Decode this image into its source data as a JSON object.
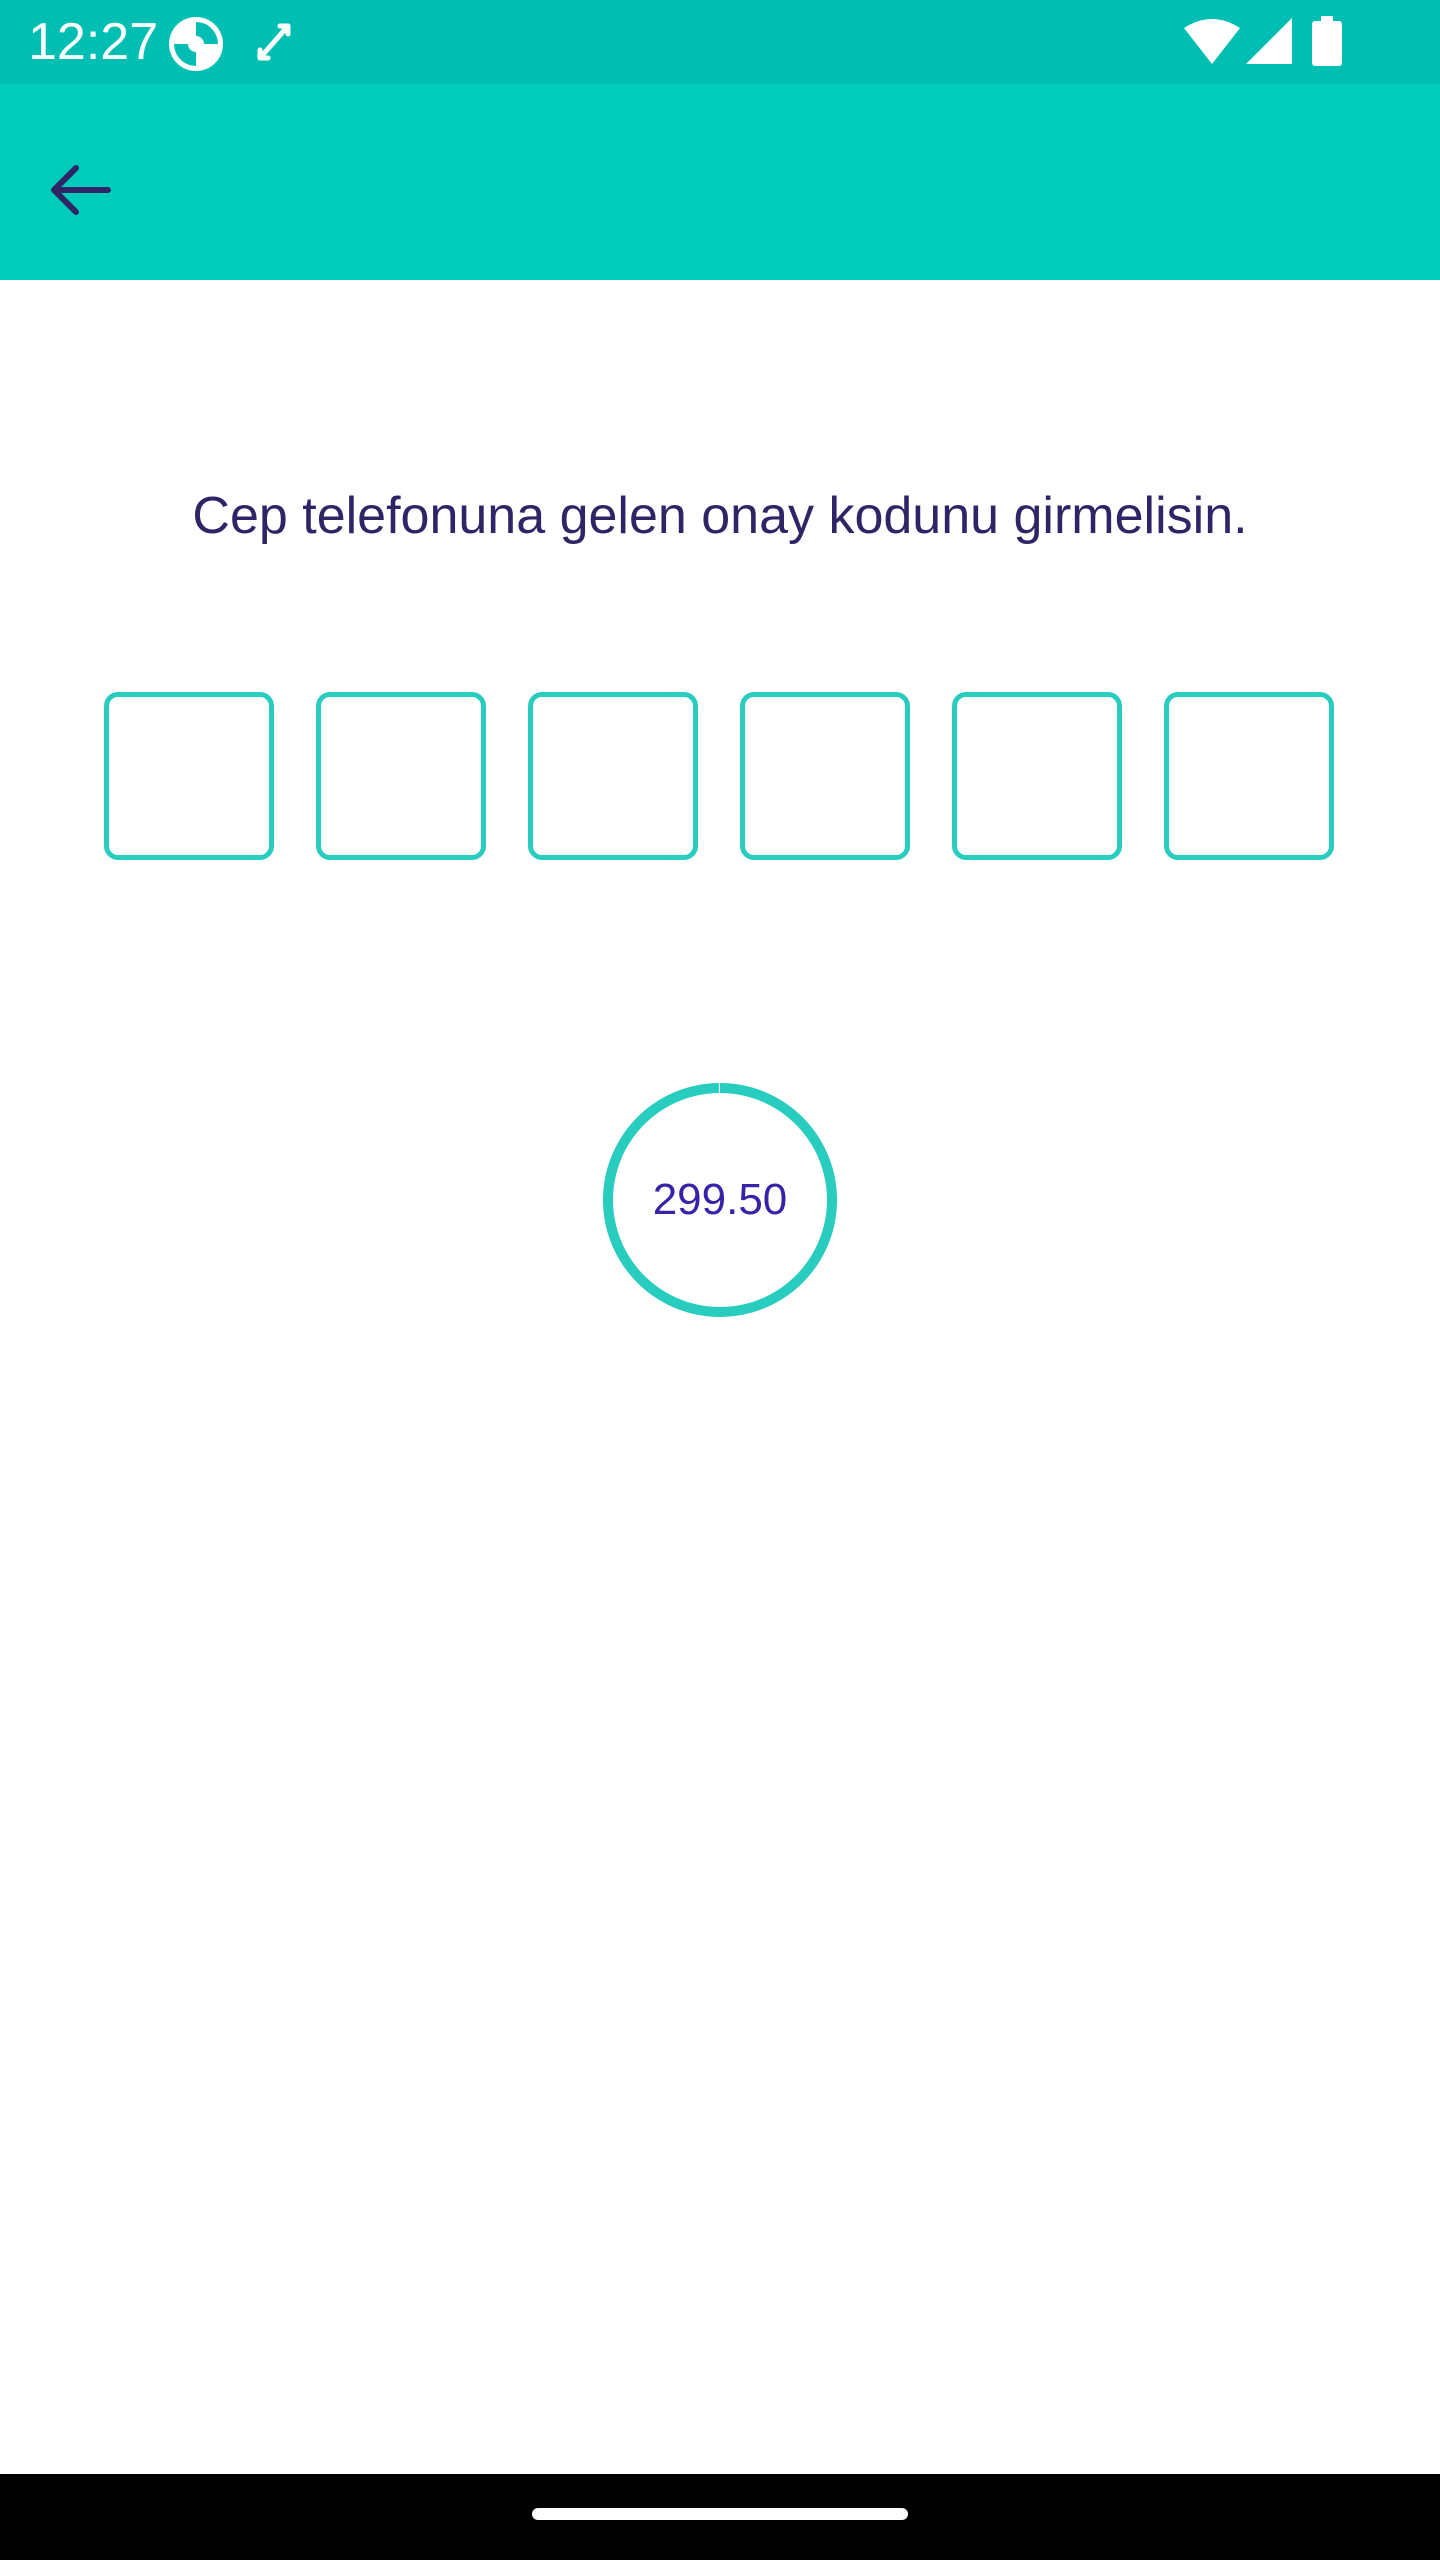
{
  "status_bar": {
    "time": "12:27",
    "background_color": "#00bfb2",
    "icons": [
      "app-notification-icon",
      "screen-rotate-icon",
      "wifi-icon",
      "cell-signal-icon",
      "battery-icon"
    ]
  },
  "app_bar": {
    "background_color": "#00ccbc",
    "back_icon": "arrow-left-icon"
  },
  "main": {
    "instruction": "Cep telefonuna gelen onay kodunu girmelisin.",
    "otp": {
      "digit_count": 6,
      "values": [
        "",
        "",
        "",
        "",
        "",
        ""
      ],
      "border_color": "#28cdbf"
    },
    "countdown": {
      "text": "299.50",
      "remaining_fraction": 0.998,
      "ring_color": "#28cdbf",
      "text_color": "#3a22a8"
    }
  },
  "colors": {
    "text_primary": "#2f2566"
  }
}
